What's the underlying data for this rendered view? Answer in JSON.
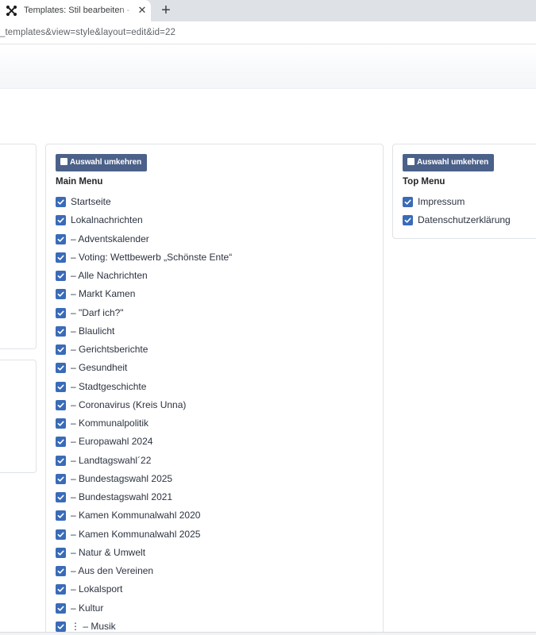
{
  "browser": {
    "tab_title": "Templates: Stil bearbeiten - Nachr",
    "tab_close_icon": "close-icon",
    "new_tab_icon": "plus-icon",
    "url": "_templates&view=style&layout=edit&id=22"
  },
  "main_menu": {
    "toggle_label": "Auswahl umkehren",
    "title": "Main Menu",
    "items": [
      {
        "label": "Startseite",
        "checked": true
      },
      {
        "label": "Lokalnachrichten",
        "checked": true
      },
      {
        "label": "– Adventskalender",
        "checked": true
      },
      {
        "label": "– Voting: Wettbewerb „Schönste Ente“",
        "checked": true
      },
      {
        "label": "– Alle Nachrichten",
        "checked": true
      },
      {
        "label": "– Markt Kamen",
        "checked": true
      },
      {
        "label": "– \"Darf ich?\"",
        "checked": true
      },
      {
        "label": "– Blaulicht",
        "checked": true
      },
      {
        "label": "– Gerichtsberichte",
        "checked": true
      },
      {
        "label": "– Gesundheit",
        "checked": true
      },
      {
        "label": "– Stadtgeschichte",
        "checked": true
      },
      {
        "label": "–  Coronavirus (Kreis Unna)",
        "checked": true
      },
      {
        "label": "– Kommunalpolitik",
        "checked": true
      },
      {
        "label": "– Europawahl 2024",
        "checked": true
      },
      {
        "label": "– Landtagswahl´22",
        "checked": true
      },
      {
        "label": "– Bundestagswahl 2025",
        "checked": true
      },
      {
        "label": "– Bundestagswahl 2021",
        "checked": true
      },
      {
        "label": "– Kamen Kommunalwahl 2020",
        "checked": true
      },
      {
        "label": "– Kamen Kommunalwahl 2025",
        "checked": true
      },
      {
        "label": "– Natur & Umwelt",
        "checked": true
      },
      {
        "label": "– Aus den Vereinen",
        "checked": true
      },
      {
        "label": "– Lokalsport",
        "checked": true
      },
      {
        "label": "– Kultur",
        "checked": true
      },
      {
        "label": "⋮   – Musik",
        "checked": true
      }
    ]
  },
  "top_menu": {
    "toggle_label": "Auswahl umkehren",
    "title": "Top Menu",
    "items": [
      {
        "label": "Impressum",
        "checked": true
      },
      {
        "label": "Datenschutzerklärung",
        "checked": true
      }
    ]
  },
  "colors": {
    "accent": "#4b6189",
    "checkbox": "#3a6bb8"
  }
}
